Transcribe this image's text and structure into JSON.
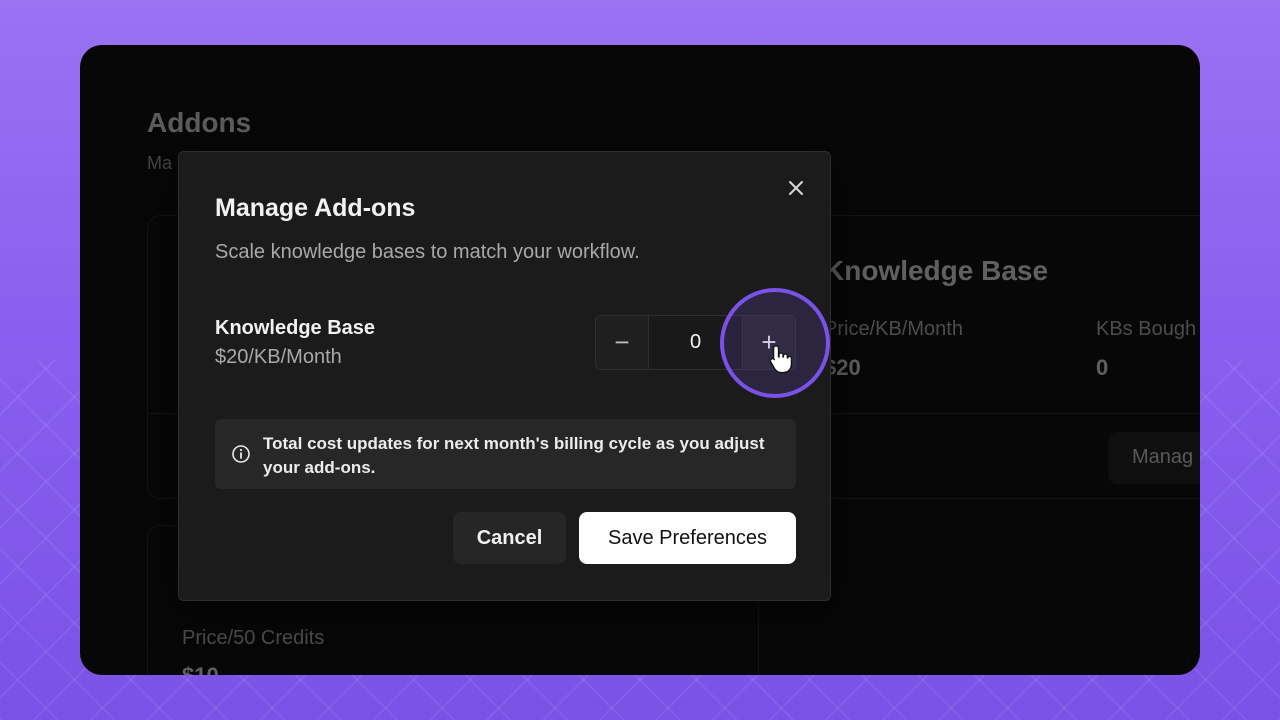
{
  "background_page": {
    "title": "Addons",
    "subtitle": "Ma",
    "knowledge_base_card": {
      "title": "Knowledge Base",
      "price_label": "Price/KB/Month",
      "price_value": "$20",
      "bought_label": "KBs Bough",
      "bought_value": "0",
      "manage_button": "Manag"
    },
    "credits_card": {
      "price_label": "Price/50 Credits",
      "price_value": "$10"
    }
  },
  "modal": {
    "title": "Manage Add-ons",
    "subtitle": "Scale knowledge bases to match your workflow.",
    "close_icon": "close-icon",
    "addon": {
      "name": "Knowledge Base",
      "price": "$20/KB/Month",
      "quantity": "0",
      "decrement_symbol": "−",
      "increment_symbol": "+"
    },
    "info": {
      "icon": "info-icon",
      "text": "Total cost updates for next month's billing cycle as you adjust your add-ons."
    },
    "cancel_label": "Cancel",
    "save_label": "Save Preferences"
  },
  "colors": {
    "accent": "#7b52e8",
    "modal_bg": "#1b1b1b",
    "page_bg": "#070707"
  }
}
